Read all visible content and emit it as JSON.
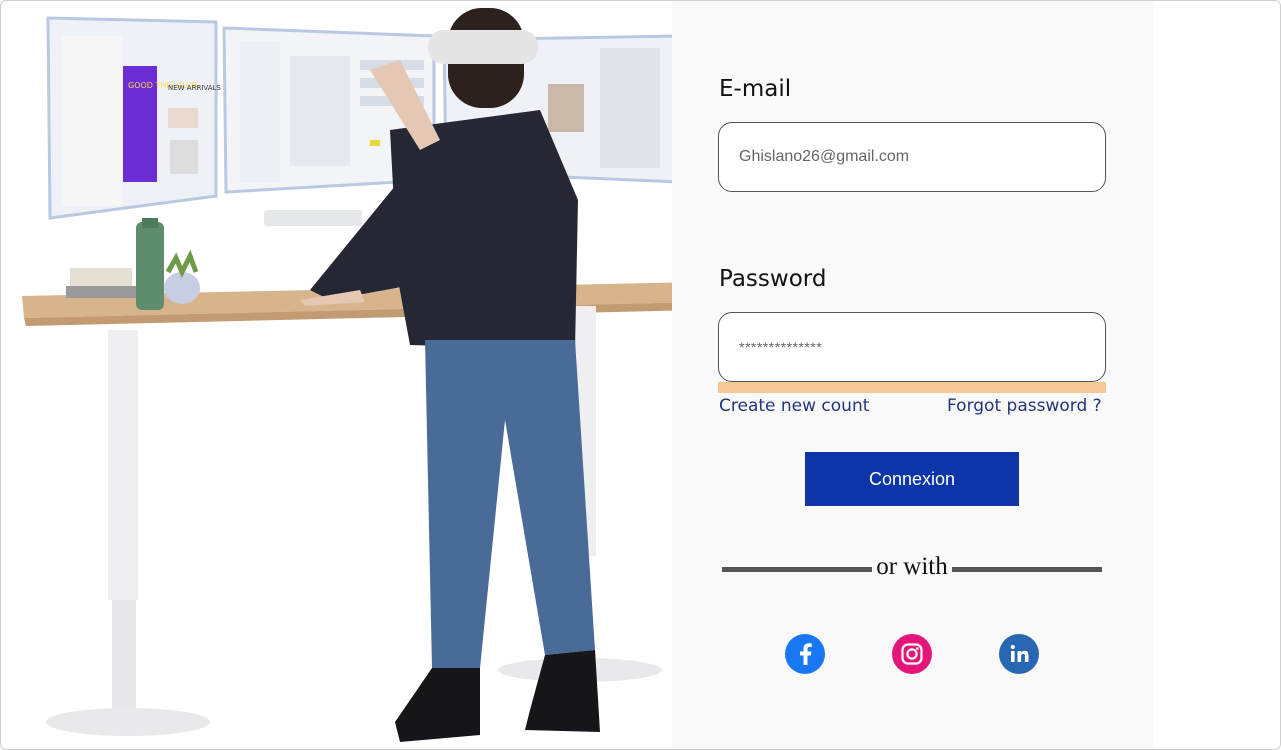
{
  "form": {
    "email_label": "E-mail",
    "email_value": "Ghislano26@gmail.com",
    "password_label": "Password",
    "password_value": "**************",
    "create_account_link": "Create new count",
    "forgot_password_link": "Forgot password ?",
    "submit_label": "Connexion",
    "divider_text": "or with"
  },
  "social": [
    {
      "name": "facebook-icon",
      "color": "#1877f2"
    },
    {
      "name": "instagram-icon",
      "color": "#e4157a"
    },
    {
      "name": "linkedin-icon",
      "color": "#2867b2"
    }
  ],
  "illustration": {
    "colors": {
      "desk_top": "#d8b48d",
      "desk_leg": "#efeef0",
      "jacket": "#252734",
      "jeans": "#4a6a97",
      "bottle": "#5f8c6c",
      "headset": "#e5e5e5"
    },
    "screen_texts": [
      "GOOD THIS CLUB",
      "NEW ARRIVALS"
    ]
  }
}
